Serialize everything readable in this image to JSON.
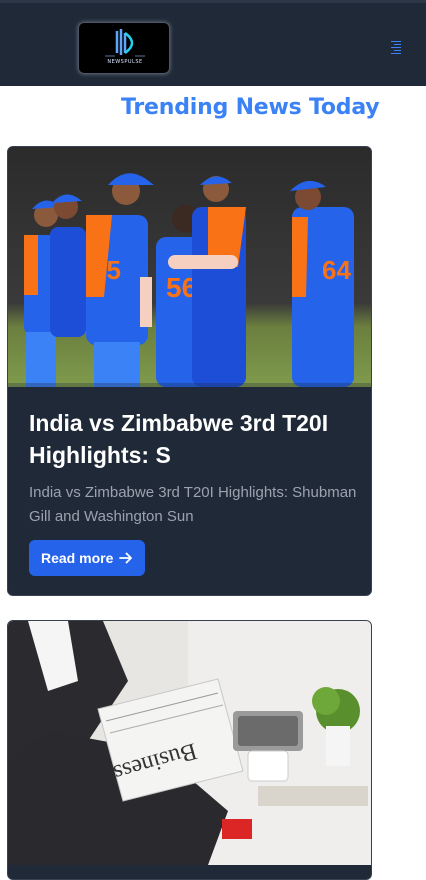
{
  "header": {
    "logo_text": "NEWSPULSE",
    "menu_icon": "hamburger-menu-icon"
  },
  "page": {
    "title": "Trending News Today"
  },
  "articles": [
    {
      "title": "India vs Zimbabwe 3rd T20I Highlights: S",
      "description": "India vs Zimbabwe 3rd T20I Highlights: Shubman Gill and Washington Sun",
      "read_more_label": "Read more",
      "image_alt": "cricket-team-celebration-image"
    },
    {
      "image_alt": "man-reading-business-newspaper-image"
    }
  ],
  "colors": {
    "header_bg": "#1f2937",
    "accent": "#3b82f6",
    "button": "#2563eb",
    "card_bg": "#1f2937"
  }
}
